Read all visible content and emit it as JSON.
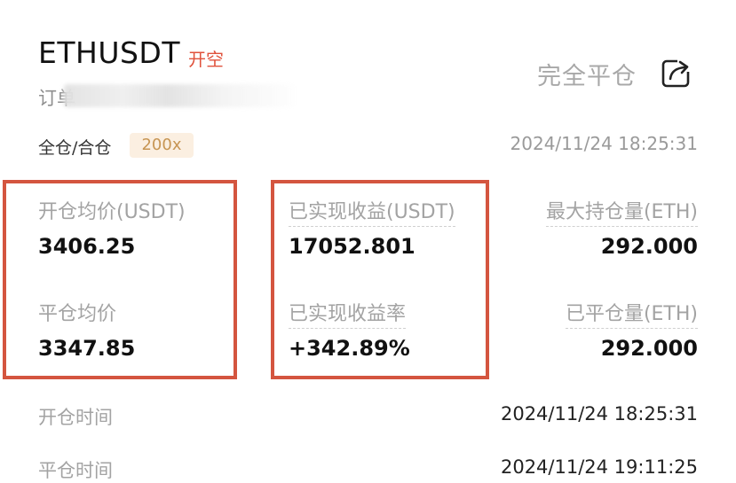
{
  "header": {
    "symbol": "ETHUSDT",
    "side_tag": "开空",
    "close_all_label": "完全平仓",
    "order_label": "订单"
  },
  "position": {
    "margin_mode": "全仓/合仓",
    "leverage": "200x",
    "open_timestamp": "2024/11/24 18:25:31"
  },
  "metrics": {
    "avg_open_price_label": "开仓均价(USDT)",
    "avg_open_price_value": "3406.25",
    "avg_close_price_label": "平仓均价",
    "avg_close_price_value": "3347.85",
    "realized_pnl_label": "已实现收益(USDT)",
    "realized_pnl_value": "17052.801",
    "realized_pnl_rate_label": "已实现收益率",
    "realized_pnl_rate_value": "+342.89%",
    "max_position_label": "最大持仓量(ETH)",
    "max_position_value": "292.000",
    "closed_amount_label": "已平仓量(ETH)",
    "closed_amount_value": "292.000"
  },
  "times": {
    "open_time_label": "开仓时间",
    "open_time_value": "2024/11/24 18:25:31",
    "close_time_label": "平仓时间",
    "close_time_value": "2024/11/24 19:11:25"
  },
  "colors": {
    "short_red": "#e0523c",
    "highlight_box": "#d4553f",
    "leverage_bg": "#fbefe1",
    "leverage_text": "#c79553"
  },
  "icons": {
    "share": "share-icon"
  }
}
